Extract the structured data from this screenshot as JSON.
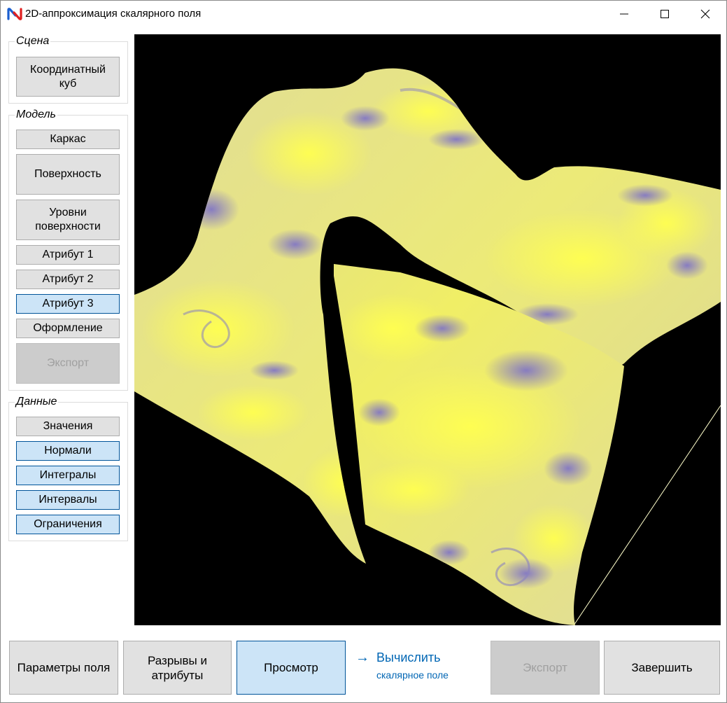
{
  "window": {
    "title": "2D-аппроксимация скалярного поля",
    "controls": {
      "minimize": "—",
      "maximize": "☐",
      "close": "✕"
    }
  },
  "scene_group": {
    "label": "Сцена",
    "coord_cube": "Координатный куб"
  },
  "model_group": {
    "label": "Модель",
    "items": [
      {
        "label": "Каркас",
        "state": "normal"
      },
      {
        "label": "Поверхность",
        "state": "normal"
      },
      {
        "label": "Уровни поверхности",
        "state": "normal"
      },
      {
        "label": "Атрибут 1",
        "state": "normal"
      },
      {
        "label": "Атрибут 2",
        "state": "normal"
      },
      {
        "label": "Атрибут 3",
        "state": "active"
      },
      {
        "label": "Оформление",
        "state": "normal"
      },
      {
        "label": "Экспорт",
        "state": "disabled"
      }
    ]
  },
  "data_group": {
    "label": "Данные",
    "items": [
      {
        "label": "Значения",
        "state": "normal"
      },
      {
        "label": "Нормали",
        "state": "active"
      },
      {
        "label": "Интегралы",
        "state": "active"
      },
      {
        "label": "Интервалы",
        "state": "active"
      },
      {
        "label": "Ограничения",
        "state": "active"
      }
    ]
  },
  "bottom_bar": {
    "field_params": "Параметры поля",
    "breaks_attrs": "Разрывы и атрибуты",
    "preview": "Просмотр",
    "compute_arrow": "→",
    "compute_title": "Вычислить",
    "compute_subtitle": "скалярное поле",
    "export": "Экспорт",
    "finish": "Завершить"
  },
  "colors": {
    "viewport_bg": "#000000",
    "surface_yellow": "#f2f060",
    "surface_beige": "#dcd8a0",
    "surface_purple": "#8a80c8",
    "active_button": "#cce4f7",
    "accent_link": "#0066b4"
  }
}
